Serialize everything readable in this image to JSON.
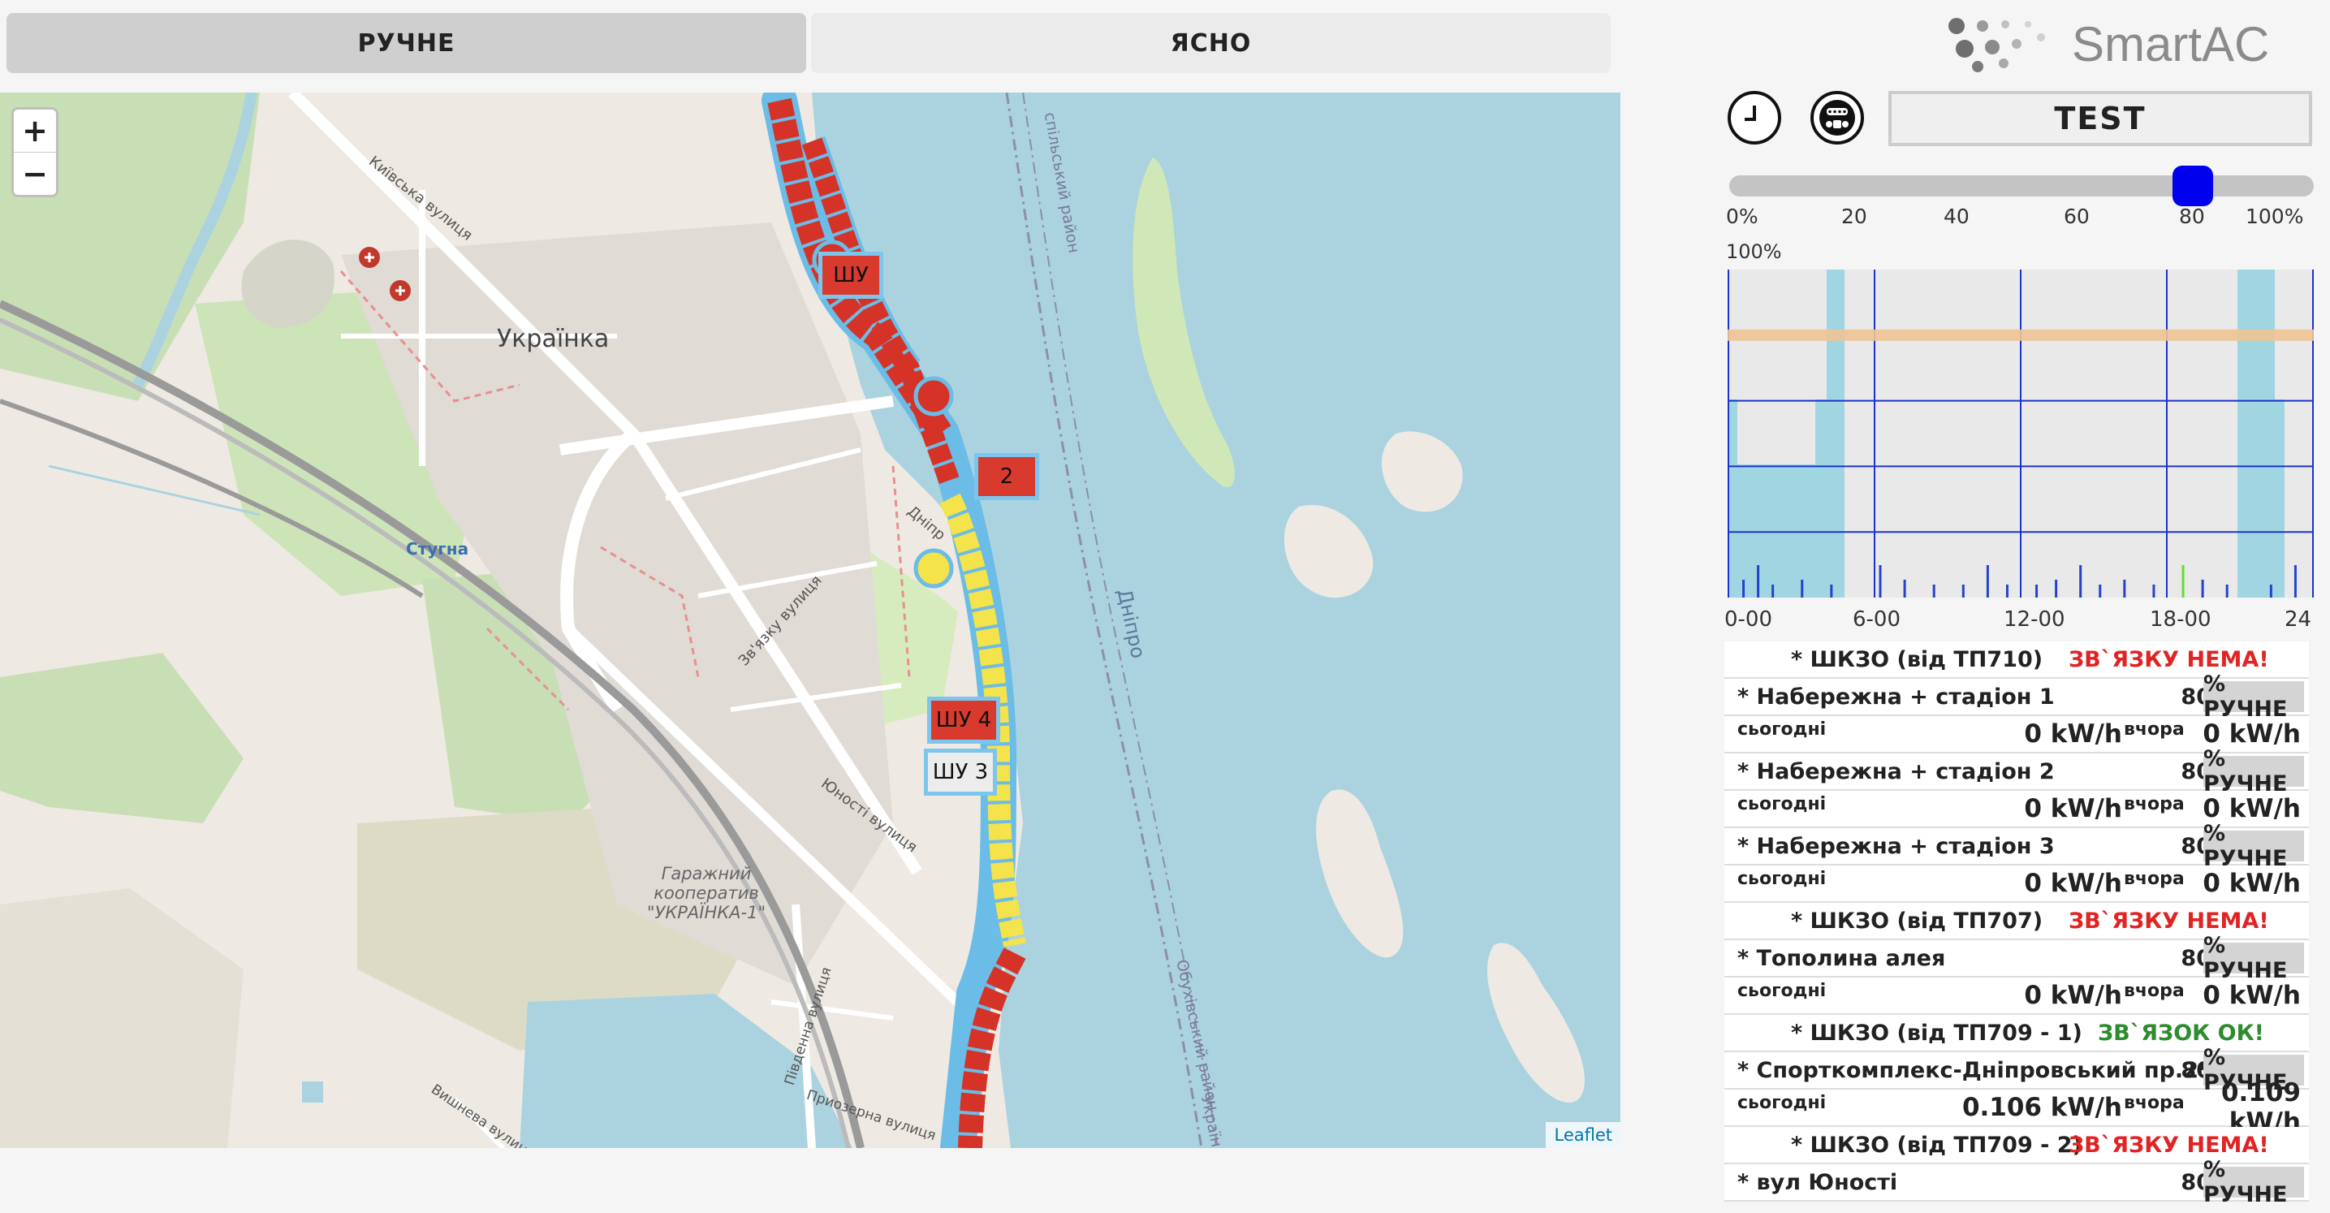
{
  "tabs": {
    "mode_label": "РУЧНЕ",
    "weather_label": "ЯСНО"
  },
  "logo": {
    "text": "SmartAC"
  },
  "controls": {
    "test_label": "TEST"
  },
  "slider": {
    "value": 80,
    "ticks": [
      "0%",
      "20",
      "40",
      "60",
      "80",
      "100%"
    ]
  },
  "map": {
    "zoom_in": "+",
    "zoom_out": "−",
    "attribution": "Leaflet",
    "labels": {
      "town": "Українка",
      "river": "Дніпро",
      "stugna": "Стугна",
      "kyivska": "Київська вулиця",
      "garage": "Гаражний кооператив \"УКРАЇНКА-1\"",
      "yunosti": "Юності вулиця",
      "zyazku": "Зв'язку вулиця",
      "dnipr_street": "Дніпр",
      "pivdenna": "Південна вулиця",
      "pryozerna": "Приозерна вулиця",
      "vyshneva": "Вишнева вулиця",
      "obukhiv": "Обухівський район",
      "raion_top": "спільський район",
      "ukrain_edge": "Україн"
    },
    "boxes": {
      "b1": "ШУ",
      "b2": "2",
      "b4": "ШУ 4",
      "b3": "ШУ 3"
    }
  },
  "chart_data": {
    "type": "bar",
    "ylabel": "100%",
    "x_ticks": [
      "0-00",
      "6-00",
      "12-00",
      "18-00",
      "24"
    ],
    "xlim": [
      0,
      24
    ],
    "level_line": 80,
    "colors": {
      "background": "#e9e9e9",
      "grid": "#1a33cc",
      "band": "#9fd6e2",
      "level": "#eec494",
      "bar": "#2244cc",
      "bar_highlight": "#66dd33"
    }
  },
  "groups": {
    "g1": {
      "name": "* ШКЗО (від ТП710)",
      "status": "ЗВ`ЯЗКУ НЕМА!",
      "status_color": "#e02424"
    },
    "d1": {
      "name": "* Набережна + стадіон 1",
      "value": "80",
      "mode": "% РУЧНЕ",
      "today_label": "сьогодні",
      "today": "0 kW/h",
      "yest_label": "вчора",
      "yest": "0 kW/h"
    },
    "d2": {
      "name": "* Набережна + стадіон 2",
      "value": "80",
      "mode": "% РУЧНЕ",
      "today_label": "сьогодні",
      "today": "0 kW/h",
      "yest_label": "вчора",
      "yest": "0 kW/h"
    },
    "d3": {
      "name": "* Набережна + стадіон 3",
      "value": "80",
      "mode": "% РУЧНЕ",
      "today_label": "сьогодні",
      "today": "0 kW/h",
      "yest_label": "вчора",
      "yest": "0 kW/h"
    },
    "g2": {
      "name": "* ШКЗО (від ТП707)",
      "status": "ЗВ`ЯЗКУ НЕМА!",
      "status_color": "#e02424"
    },
    "d4": {
      "name": "* Тополина алея",
      "value": "80",
      "mode": "% РУЧНЕ",
      "today_label": "сьогодні",
      "today": "0 kW/h",
      "yest_label": "вчора",
      "yest": "0 kW/h"
    },
    "g3": {
      "name": "* ШКЗО (від ТП709 - 1)",
      "status": "ЗВ`ЯЗОК ОК!",
      "status_color": "#2e8b2e"
    },
    "d5": {
      "name": "* Спорткомплекс-Дніпровський пр.25",
      "value": "80",
      "mode": "% РУЧНЕ",
      "today_label": "сьогодні",
      "today": "0.106 kW/h",
      "yest_label": "вчора",
      "yest": "0.109 kW/h"
    },
    "g4": {
      "name": "* ШКЗО (від ТП709 - 2)",
      "status": "ЗВ`ЯЗКУ НЕМА!",
      "status_color": "#e02424"
    },
    "d6": {
      "name": "* вул Юності",
      "value": "80",
      "mode": "% РУЧНЕ"
    }
  }
}
